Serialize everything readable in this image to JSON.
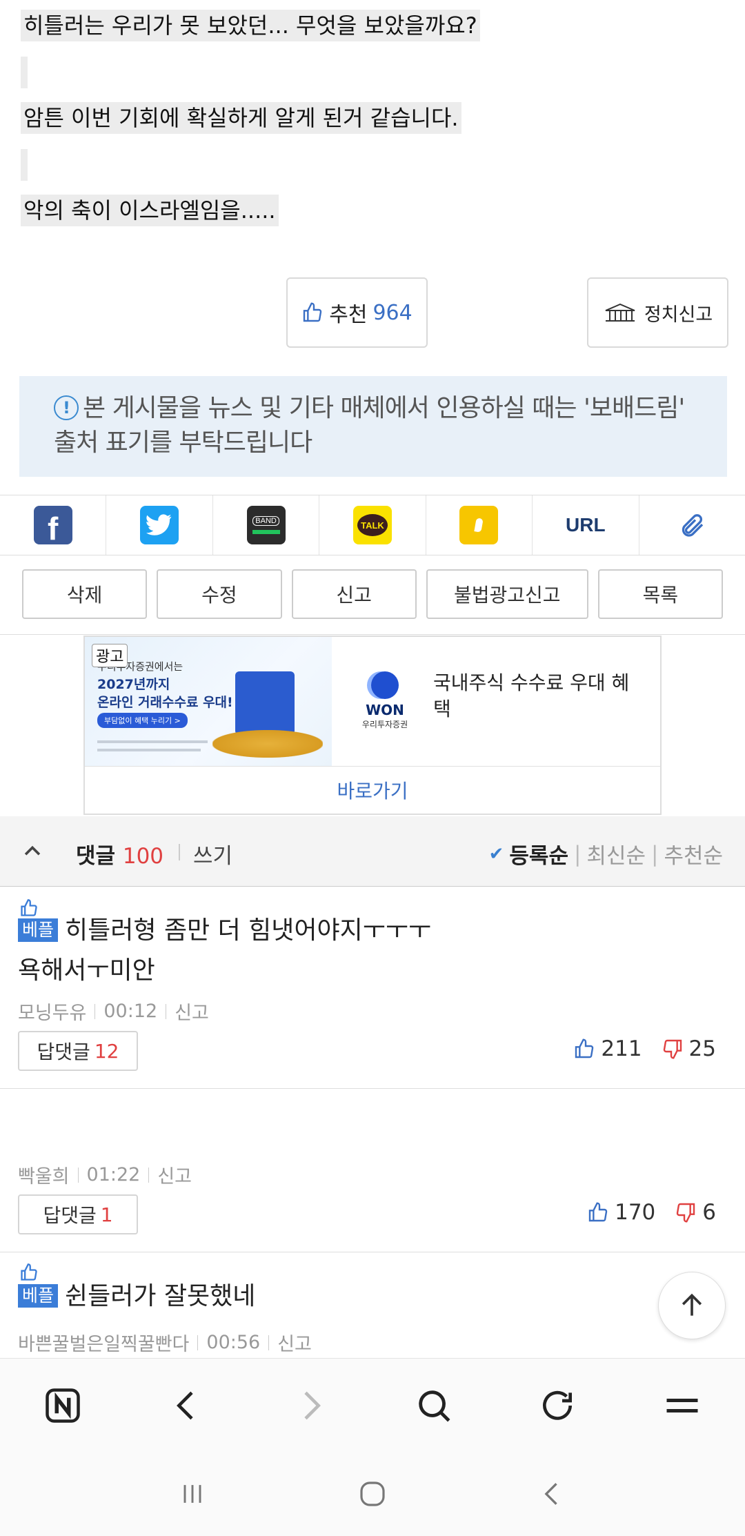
{
  "post": {
    "line1": "히틀러는 우리가 못 보았던... 무엇을 보았을까요?",
    "line2": "암튼 이번 기회에 확실하게 알게 된거 같습니다.",
    "line3": "악의 축이 이스라엘임을....."
  },
  "recommend": {
    "label": "추천",
    "count": "964"
  },
  "political_report": {
    "label": "정치신고"
  },
  "notice": {
    "text": "본 게시물을 뉴스 및 기타 매체에서 인용하실 때는 '보배드림' 출처 표기를 부탁드립니다"
  },
  "share": {
    "items": [
      {
        "name": "facebook",
        "label": "f",
        "color": "#3b5998"
      },
      {
        "name": "twitter",
        "label": "",
        "color": "#1da1f2"
      },
      {
        "name": "band",
        "label": "BAND",
        "color": "#2c2c2c"
      },
      {
        "name": "kakaotalk",
        "label": "TALK",
        "color": "#fae100"
      },
      {
        "name": "kakaostory",
        "label": "",
        "color": "#f7c600"
      },
      {
        "name": "url",
        "label": "URL",
        "color": "#1d3c6e"
      },
      {
        "name": "clip",
        "label": "",
        "color": "#3a6fc4"
      }
    ]
  },
  "actions": {
    "delete": "삭제",
    "edit": "수정",
    "report": "신고",
    "illegal_ad_report": "불법광고신고",
    "list": "목록"
  },
  "ad": {
    "tag": "광고",
    "img_line1": "우리투자증권에서는",
    "img_line2": "2027년까지",
    "img_line3": "온라인 거래수수료 우대!",
    "img_pill": "부담없이 혜택 누리기 >",
    "logo_text": "WON",
    "logo_sub": "우리투자증권",
    "text": "국내주식 수수료 우대 혜택",
    "go": "바로가기"
  },
  "comments_header": {
    "title": "댓글",
    "count": "100",
    "write": "쓰기",
    "sort_registered": "등록순",
    "sort_latest": "최신순",
    "sort_recommended": "추천순"
  },
  "comments": [
    {
      "badge": "베플",
      "text_line1": "히틀러형 좀만 더 힘냇어야지ㅜㅜㅜ",
      "text_line2": "욕해서ㅜ미안",
      "author": "모닝두유",
      "time": "00:12",
      "report": "신고",
      "reply_label": "답댓글",
      "reply_count": "12",
      "up": "211",
      "down": "25"
    },
    {
      "author": "빡울희",
      "time": "01:22",
      "report": "신고",
      "reply_label": "답댓글",
      "reply_count": "1",
      "up": "170",
      "down": "6"
    },
    {
      "badge": "베플",
      "text_line1": "쉰들러가 잘못했네",
      "author": "바쁜꿀벌은일찍꿀빤다",
      "time": "00:56",
      "report": "신고"
    }
  ],
  "colors": {
    "accent_blue": "#3a6fc4",
    "count_red": "#e04040",
    "badge_blue": "#3b7dd8"
  }
}
